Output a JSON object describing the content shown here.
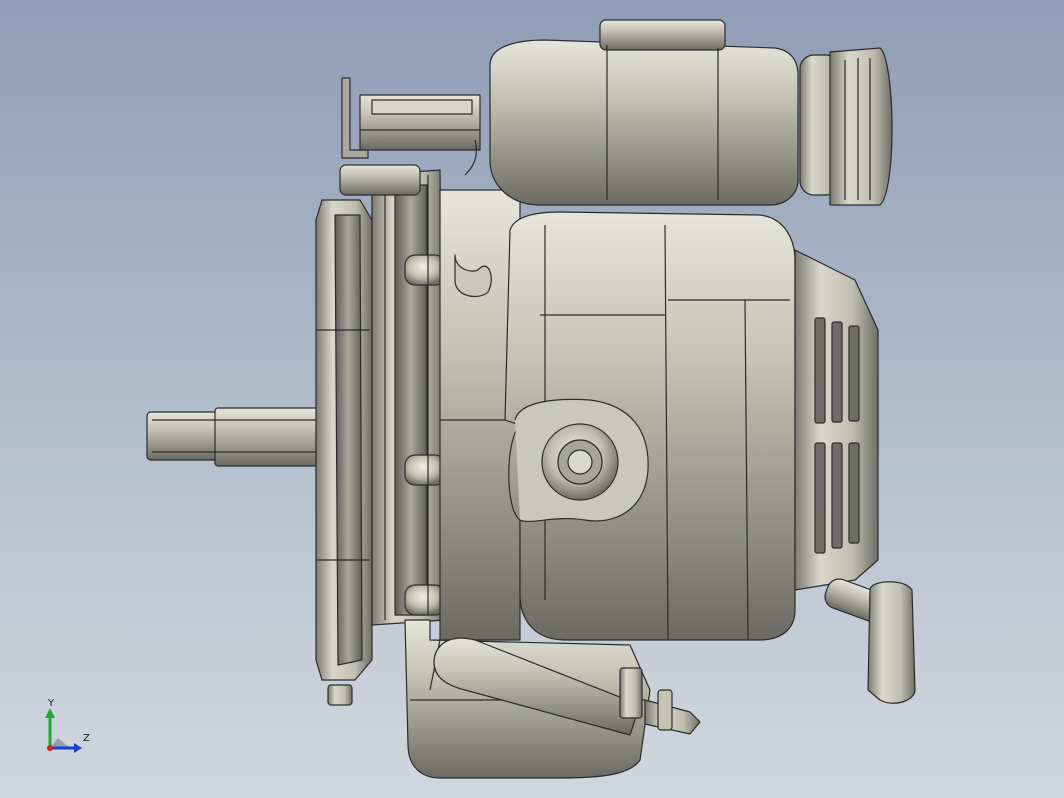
{
  "viewport": {
    "background_top": "#8e9db5",
    "background_bottom": "#d2d7de",
    "model_color": "#bdbcb0",
    "edge_color": "#2b2b2b"
  },
  "triad": {
    "y_label": "Y",
    "z_label": "Z",
    "y_color": "#1faa2a",
    "z_color": "#1f3fd0",
    "x_color": "#d02020"
  }
}
